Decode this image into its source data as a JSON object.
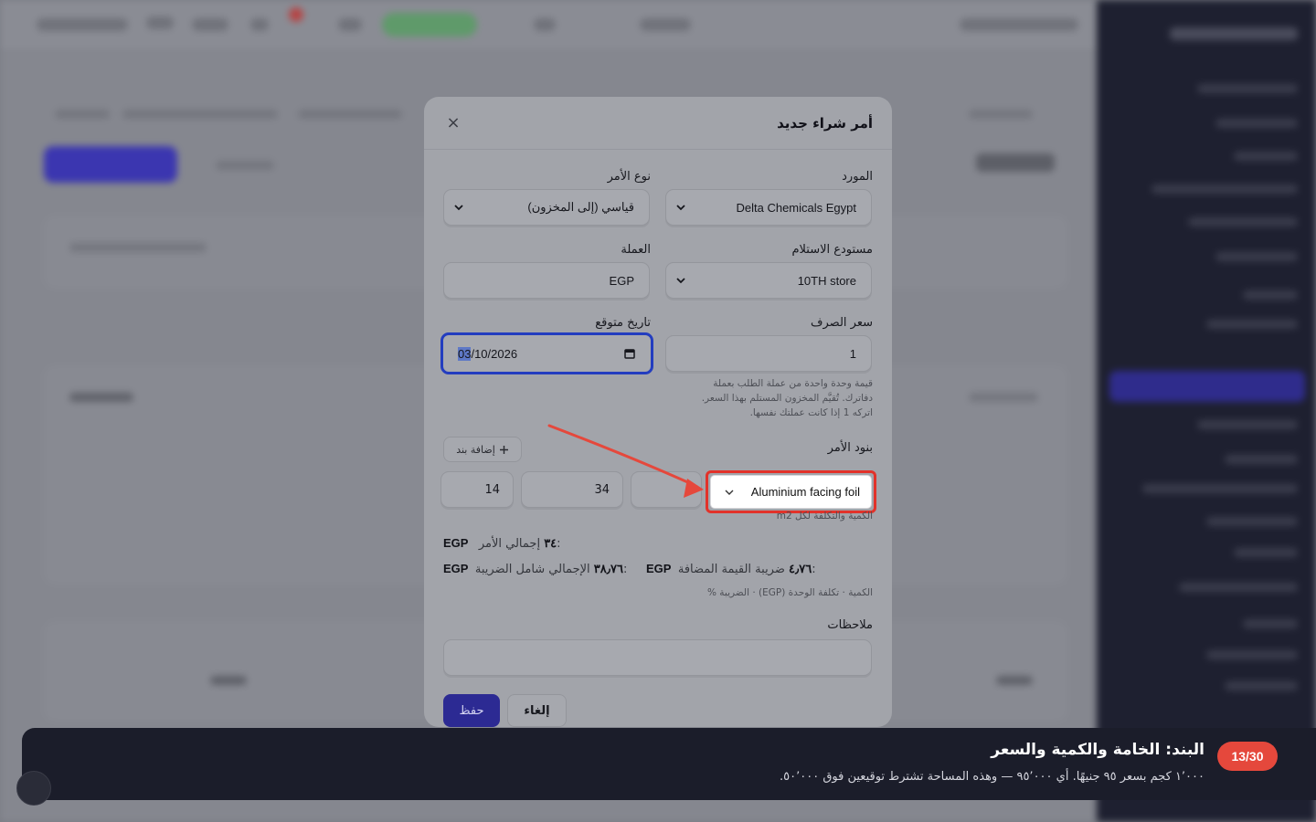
{
  "modal": {
    "title": "أمر شراء جديد",
    "close_label": "×",
    "supplier": {
      "label": "المورد",
      "value": "Delta Chemicals Egypt"
    },
    "order_type": {
      "label": "نوع الأمر",
      "value": "قياسي (إلى المخزون)"
    },
    "warehouse": {
      "label": "مستودع الاستلام",
      "value": "10TH store"
    },
    "currency": {
      "label": "العملة",
      "value": "EGP"
    },
    "exchange_rate": {
      "label": "سعر الصرف",
      "value": "1",
      "help_1": "قيمة وحدة واحدة من عملة الطلب بعملة",
      "help_2": "دفاترك. تُقيَّم المخزون المستلم بهذا السعر.",
      "help_3": "اتركه 1 إذا كانت عملتك نفسها."
    },
    "expected_date": {
      "label": "تاريخ متوقع",
      "month": "03",
      "rest": "/10/2026"
    },
    "lines": {
      "label": "بنود الأمر",
      "add_button": "إضافة بند",
      "item": "Aluminium facing foil",
      "quantity": "",
      "unit_cost": "34",
      "tax": "14",
      "unit_hint": "الكمية والتكلفة لكل m2",
      "columns_hint": "الكمية · تكلفة الوحدة (EGP) · الضريبة %"
    },
    "totals": {
      "order_total_label": "إجمالي الأمر:",
      "order_total_value": "EGP ٣٤",
      "vat_label": "ضريبة القيمة المضافة:",
      "vat_value": "EGP ٤٫٧٦",
      "grand_total_label": "الإجمالي شامل الضريبة:",
      "grand_total_value": "EGP ٣٨٫٧٦"
    },
    "notes": {
      "label": "ملاحظات",
      "value": ""
    },
    "save_label": "حفظ",
    "cancel_label": "إلغاء"
  },
  "tutorial": {
    "step": "13/30",
    "title": "البند: الخامة والكمية والسعر",
    "text": "١٬٠٠٠ كجم بسعر ٩٥ جنيهًا. أي ٩٥٬٠٠٠ — وهذه المساحة تشترط توقيعين فوق ٥٠٬٠٠٠."
  },
  "colors": {
    "accent": "#2c2a93",
    "highlight": "#e2322a",
    "badge": "#e5483c",
    "focus_ring": "#233dbf"
  },
  "icons": [
    "close-icon",
    "chevron-down-icon",
    "calendar-icon",
    "plus-icon",
    "arrow-pointer"
  ]
}
